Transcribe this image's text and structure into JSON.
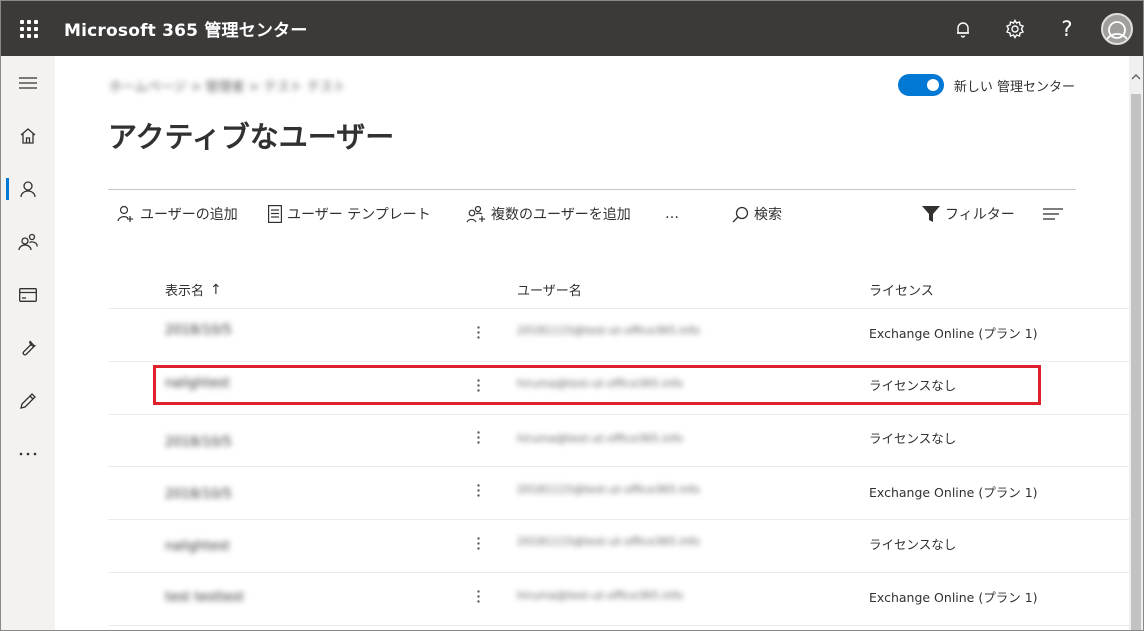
{
  "app": {
    "title": "Microsoft 365 管理センター"
  },
  "header": {
    "breadcrumb": "ホームページ > 管理者 > テスト テスト",
    "toggle_label": "新しい 管理センター",
    "page_title": "アクティブなユーザー"
  },
  "toolbar": {
    "add_user": "ユーザーの追加",
    "user_template": "ユーザー テンプレート",
    "add_multiple_users": "複数のユーザーを追加",
    "more": "…",
    "search": "検索",
    "filter": "フィルター"
  },
  "table": {
    "columns": {
      "display_name": "表示名",
      "sort_indicator": "↑",
      "username": "ユーザー名",
      "license": "ライセンス"
    },
    "rows": [
      {
        "name": "2018/10/5",
        "username": "20181115@test-ut-office365.info",
        "license": "Exchange Online (プラン 1)"
      },
      {
        "name": "nalightest",
        "username": "hiruma@test-ut-office365.info",
        "license": "ライセンスなし"
      },
      {
        "name": "2018/10/5",
        "username": "hiruma@test-ut-office365.info",
        "license": "ライセンスなし"
      },
      {
        "name": "2018/10/5",
        "username": "20181115@test-ut-office365.info",
        "license": "Exchange Online (プラン 1)"
      },
      {
        "name": "nalightest",
        "username": "20181115@test-ut-office365.info",
        "license": "ライセンスなし"
      },
      {
        "name": "test testtest",
        "username": "hiruma@test-ut-office365.info",
        "license": "Exchange Online (プラン 1)"
      }
    ]
  },
  "icons": {
    "waffle": "app-launcher-icon",
    "notifications": "bell-icon",
    "settings": "gear-icon",
    "help": "help-icon",
    "help_glyph": "?"
  },
  "colors": {
    "topbar": "#3b3a39",
    "accent": "#0078d4",
    "highlight": "#e0202a"
  }
}
